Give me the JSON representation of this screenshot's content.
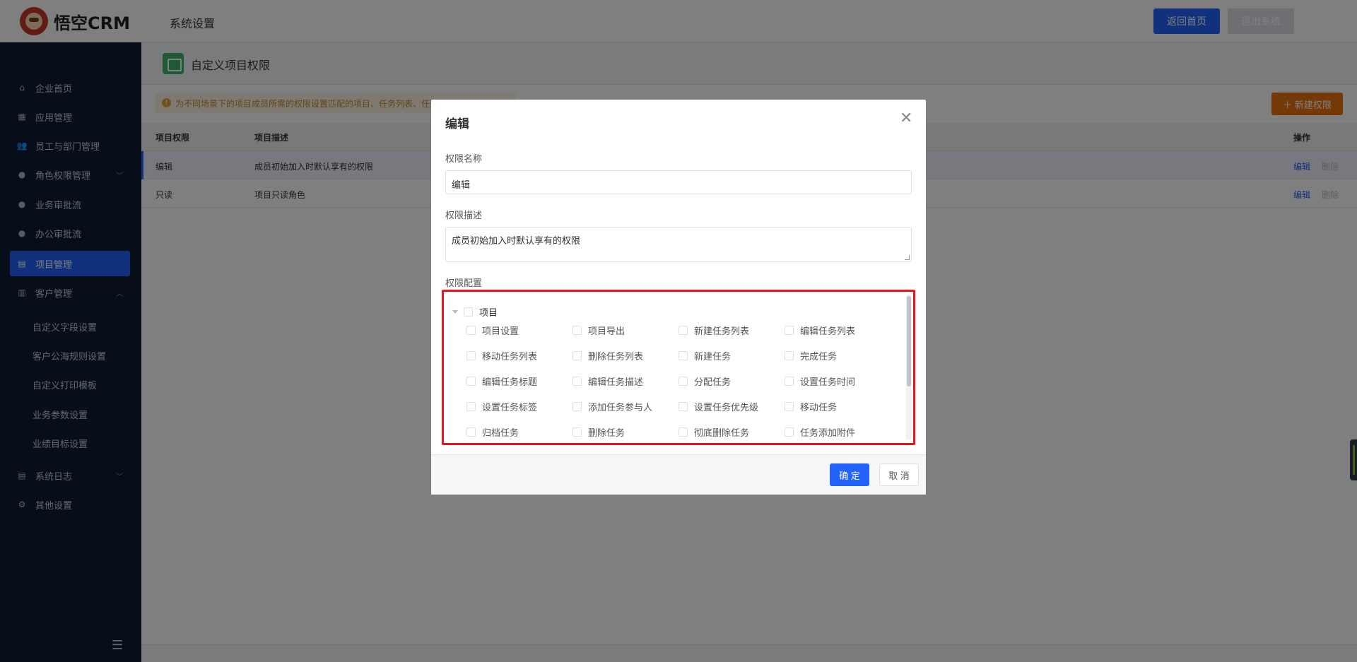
{
  "header": {
    "logo_text": "悟空CRM",
    "title": "系统设置",
    "home_button": "返回首页",
    "exit_button": "退出系统"
  },
  "sidebar": {
    "items": [
      {
        "label": "企业首页",
        "icon": "home-icon"
      },
      {
        "label": "应用管理",
        "icon": "grid-icon"
      },
      {
        "label": "员工与部门管理",
        "icon": "users-icon"
      },
      {
        "label": "角色权限管理",
        "icon": "user-icon"
      },
      {
        "label": "业务审批流",
        "icon": "user-icon"
      },
      {
        "label": "办公审批流",
        "icon": "user-icon"
      },
      {
        "label": "项目管理",
        "icon": "board-icon"
      },
      {
        "label": "客户管理",
        "icon": "building-icon"
      },
      {
        "label": "系统日志",
        "icon": "doc-icon"
      },
      {
        "label": "其他设置",
        "icon": "gear-icon"
      }
    ],
    "customer_sub_items": [
      "自定义字段设置",
      "客户公海规则设置",
      "自定义打印模板",
      "业务参数设置",
      "业绩目标设置"
    ]
  },
  "page": {
    "title": "自定义项目权限",
    "tip": "为不同场景下的项目成员所需的权限设置匹配的项目、任务列表、任务等操作权限",
    "new_button": "新建权限",
    "table": {
      "headers": {
        "name": "项目权限",
        "desc": "项目描述",
        "action": "操作"
      },
      "rows": [
        {
          "name": "编辑",
          "desc": "成员初始加入时默认享有的权限",
          "edit": "编辑",
          "delete": "删除"
        },
        {
          "name": "只读",
          "desc": "项目只读角色",
          "edit": "编辑",
          "delete": "删除"
        }
      ]
    }
  },
  "dialog": {
    "title": "编辑",
    "name_label": "权限名称",
    "name_value": "编辑",
    "desc_label": "权限描述",
    "desc_value": "成员初始加入时默认享有的权限",
    "config_label": "权限配置",
    "tree_root": "项目",
    "permissions": [
      "项目设置",
      "项目导出",
      "新建任务列表",
      "编辑任务列表",
      "移动任务列表",
      "删除任务列表",
      "新建任务",
      "完成任务",
      "编辑任务标题",
      "编辑任务描述",
      "分配任务",
      "设置任务时间",
      "设置任务标签",
      "添加任务参与人",
      "设置任务优先级",
      "移动任务",
      "归档任务",
      "删除任务",
      "彻底删除任务",
      "任务添加附件"
    ],
    "ok_button": "确 定",
    "cancel_button": "取 消"
  }
}
